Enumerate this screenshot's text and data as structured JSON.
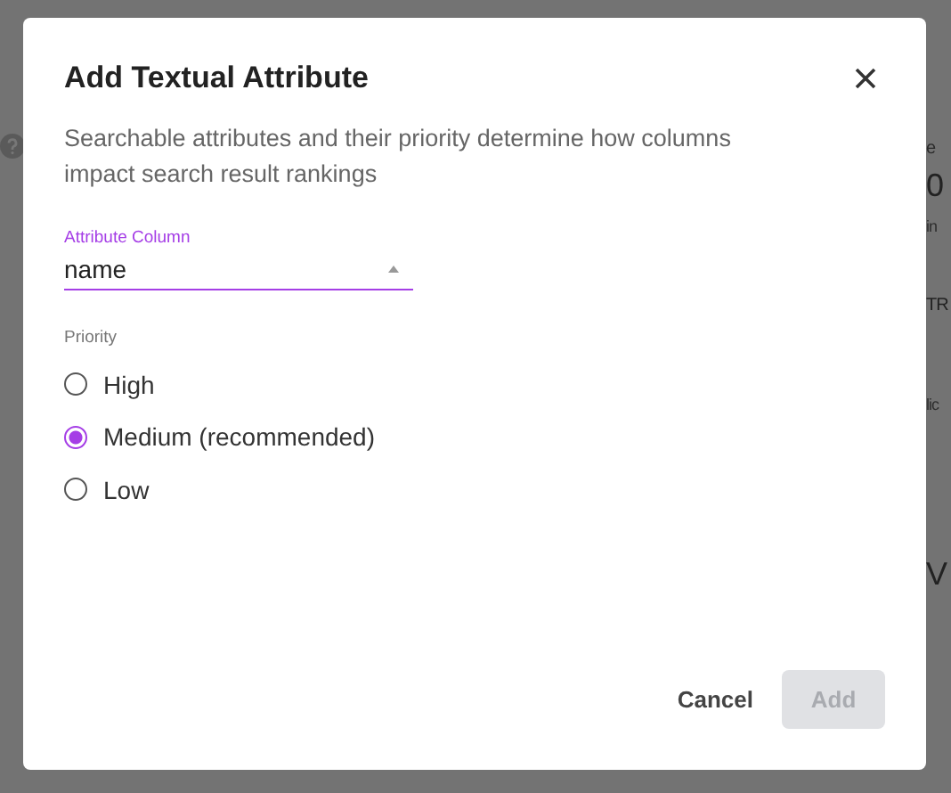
{
  "backdrop": {
    "fragments": [
      {
        "text": "e",
        "kind": "small"
      },
      {
        "text": "0",
        "kind": "big"
      },
      {
        "text": "in",
        "kind": "faint"
      },
      {
        "text": "TR",
        "kind": "normal"
      },
      {
        "text": "lic",
        "kind": "faint"
      },
      {
        "text": "V",
        "kind": "big"
      }
    ]
  },
  "dialog": {
    "title": "Add Textual Attribute",
    "description": "Searchable attributes and their priority determine how columns impact search result rankings",
    "field": {
      "label": "Attribute Column",
      "value": "name"
    },
    "priority": {
      "label": "Priority",
      "options": [
        {
          "label": "High",
          "selected": false
        },
        {
          "label": "Medium (recommended)",
          "selected": true
        },
        {
          "label": "Low",
          "selected": false
        }
      ]
    },
    "buttons": [
      {
        "label": "Cancel",
        "kind": "text",
        "disabled": false
      },
      {
        "label": "Add",
        "kind": "filled",
        "disabled": true
      }
    ]
  }
}
